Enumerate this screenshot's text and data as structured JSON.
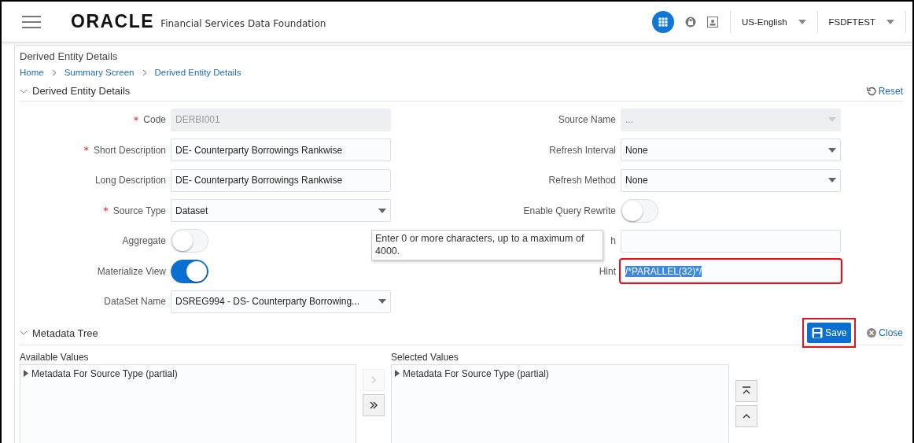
{
  "header": {
    "logo": "ORACLE",
    "product": "Financial Services Data Foundation",
    "language": "US-English",
    "user": "FSDFTEST"
  },
  "page_title": "Derived Entity Details",
  "breadcrumbs": [
    {
      "label": "Home"
    },
    {
      "label": "Summary Screen"
    },
    {
      "label": "Derived Entity Details"
    }
  ],
  "details_section": {
    "title": "Derived Entity Details",
    "expanded": true,
    "reset": "Reset",
    "left_fields": [
      {
        "kind": "text",
        "required_mark": "*",
        "label": "Code",
        "disabled": true,
        "value": "DERBI001"
      },
      {
        "kind": "text",
        "required_mark": "*",
        "label": "Short Description",
        "disabled": false,
        "value": "DE- Counterparty Borrowings Rankwise"
      },
      {
        "kind": "text",
        "label": "Long Description",
        "disabled": false,
        "value": "DE- Counterparty Borrowings Rankwise"
      },
      {
        "kind": "select",
        "required_mark": "*",
        "label": "Source Type",
        "disabled": false,
        "value": "Dataset"
      },
      {
        "kind": "toggle",
        "label": "Aggregate",
        "on": false
      },
      {
        "kind": "toggle",
        "label": "Materialize View",
        "on": true
      },
      {
        "kind": "select",
        "label": "DataSet Name",
        "disabled": false,
        "value": "DSREG994 - DS- Counterparty Borrowing..."
      }
    ],
    "right_fields": [
      {
        "kind": "select",
        "label": "Source Name",
        "disabled": true,
        "value": "..."
      },
      {
        "kind": "select",
        "label": "Refresh Interval",
        "disabled": false,
        "value": "None"
      },
      {
        "kind": "select",
        "label": "Refresh Method",
        "disabled": false,
        "value": "None"
      },
      {
        "kind": "toggle",
        "label": "Enable Query Rewrite",
        "on": false
      },
      {
        "kind": "text",
        "label": "h",
        "disabled": false
      },
      {
        "kind": "text",
        "label": "Hint",
        "disabled": false,
        "value": "/*PARALLEL(32)*/",
        "text_selected": true,
        "highlighted": true
      }
    ]
  },
  "tooltip": "Enter 0 or more characters, up to a maximum of 4000.",
  "metadata_section": {
    "title": "Metadata Tree",
    "expanded": true,
    "save": {
      "label": "Save",
      "highlighted": true
    },
    "close": "Close",
    "available": {
      "label": "Available Values",
      "items": [
        {
          "label": "Metadata For Source Type (partial)",
          "expanded": false
        }
      ]
    },
    "selected": {
      "label": "Selected Values",
      "items": [
        {
          "label": "Metadata For Source Type (partial)",
          "expanded": false
        }
      ]
    },
    "move_buttons": [
      {
        "kind": "move",
        "disabled": true
      },
      {
        "kind": "move_all",
        "disabled": false
      }
    ],
    "order_buttons": [
      {
        "kind": "top",
        "disabled": false
      },
      {
        "kind": "up",
        "disabled": false
      }
    ]
  }
}
